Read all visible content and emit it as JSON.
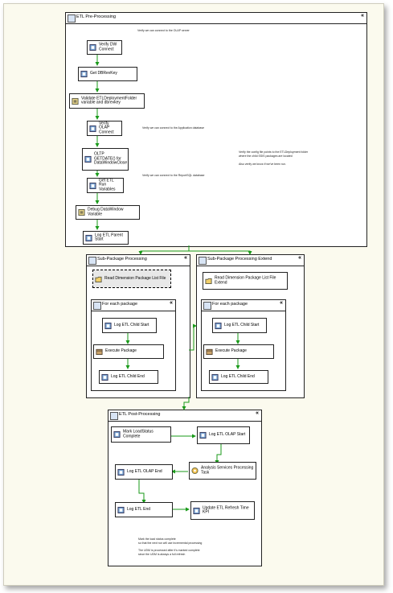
{
  "containers": {
    "pre_processing": {
      "title": "ETL Pre-Processing",
      "collapse": "«"
    },
    "sub_package_processing": {
      "title": "Sub-Package Processing",
      "collapse": "«"
    },
    "sub_foreach": {
      "title": "For each package",
      "collapse": "«"
    },
    "sub_extend": {
      "title": "Sub-Package Processing Extend",
      "collapse": "«"
    },
    "ext_foreach": {
      "title": "For each package",
      "collapse": "«"
    },
    "post_processing": {
      "title": "ETL Post-Processing",
      "collapse": "«"
    }
  },
  "tasks": {
    "verify_dw": "Verify DW Connect",
    "get_dbrevkey": "Get DBRevKey",
    "validate": "Validate ETLDeploymentFolder variable and dbrevkey",
    "verify_olap": "Verify OLAP Connect",
    "oltp_getdate": "OLTP GETDATE() for DataWindowClose",
    "get_etl_run": "Get ETL Run Variables",
    "debug_datawindow": "Debug DataWindow Variable",
    "log_etl_parent": "Log ETL Parent Start",
    "read_dim_list": "Read Dimension Package List File",
    "sub_log_child_start": "Log ETL Child Start",
    "sub_execute": "Execute Package",
    "sub_log_child_end": "Log ETL Child End",
    "read_dim_list_extend": "Read Dimension Package List File Extend",
    "ext_log_child_start": "Log ETL Child Start",
    "ext_execute": "Execute Package",
    "ext_log_child_end": "Log ETL Child End",
    "mark_loadstatus": "Mark LoadStatus Complete",
    "log_olap_start": "Log ETL OLAP Start",
    "analysis_services": "Analysis Services Processing Task",
    "log_olap_end": "Log ETL OLAP End",
    "log_etl_end": "Log ETL End",
    "update_refresh": "Update ETL Refresh Time KPI"
  },
  "annotations": {
    "olap_server": "Verify we can connect to the OLAP server",
    "app_database": "Verify we can connect to the Application database",
    "config_1": "Verify the config file points to the ETLDeployment folder",
    "config_2": "where the child SSIS packages are located",
    "config_3": "Also verify we know if we've been run.",
    "report_db": "Verify we can connect to the ReportSQL database",
    "post_1": "Mark the load status complete",
    "post_2": "so that the next run will use incremental processing",
    "post_3": "The UDM is processed after it's marked complete",
    "post_4": "since the UDM is always a full refresh"
  },
  "colors": {
    "flow_success": "#1a9a1a",
    "canvas": "#fbfaee"
  },
  "icons": {
    "task": "execute-sql-task-icon",
    "script": "script-task-icon",
    "file": "file-system-task-icon",
    "analysis": "analysis-services-icon",
    "container": "container-icon"
  }
}
